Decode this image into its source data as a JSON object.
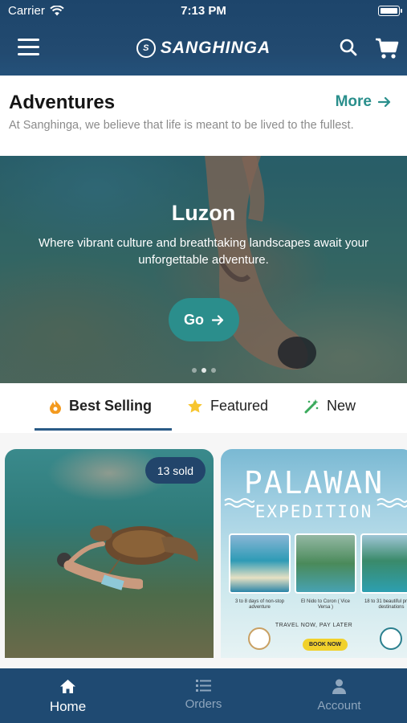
{
  "status_bar": {
    "carrier": "Carrier",
    "time": "7:13 PM"
  },
  "header": {
    "brand": "SANGHINGA",
    "brand_mark": "S"
  },
  "adventures": {
    "title": "Adventures",
    "more_label": "More",
    "description": "At Sanghinga, we believe that life is meant to be lived to the fullest."
  },
  "hero": {
    "title": "Luzon",
    "subtitle": "Where vibrant culture and breathtaking landscapes await your unforgettable adventure.",
    "go_label": "Go",
    "slide_count": 3,
    "active_slide": 1
  },
  "tabs": [
    {
      "label": "Best Selling",
      "icon": "fire-icon",
      "active": true
    },
    {
      "label": "Featured",
      "icon": "star-icon",
      "active": false
    },
    {
      "label": "New",
      "icon": "magic-wand-icon",
      "active": false
    }
  ],
  "cards": [
    {
      "badge": "13 sold"
    },
    {
      "title_line1": "PALAWAN",
      "title_line2": "EXPEDITION",
      "captions": [
        "3 to 8 days of non-stop adventure",
        "El Nido to Coron ( Vice Versa )",
        "18 to 31 beautiful pristine destinations"
      ],
      "tagline": "TRAVEL NOW, PAY LATER",
      "cta": "BOOK NOW"
    }
  ],
  "bottom_nav": [
    {
      "label": "Home",
      "icon": "home-icon",
      "active": true
    },
    {
      "label": "Orders",
      "icon": "list-icon",
      "active": false
    },
    {
      "label": "Account",
      "icon": "user-icon",
      "active": false
    }
  ],
  "colors": {
    "nav_bg": "#1f4a72",
    "accent_teal": "#2a8f8c",
    "tab_underline": "#2a5a86"
  }
}
